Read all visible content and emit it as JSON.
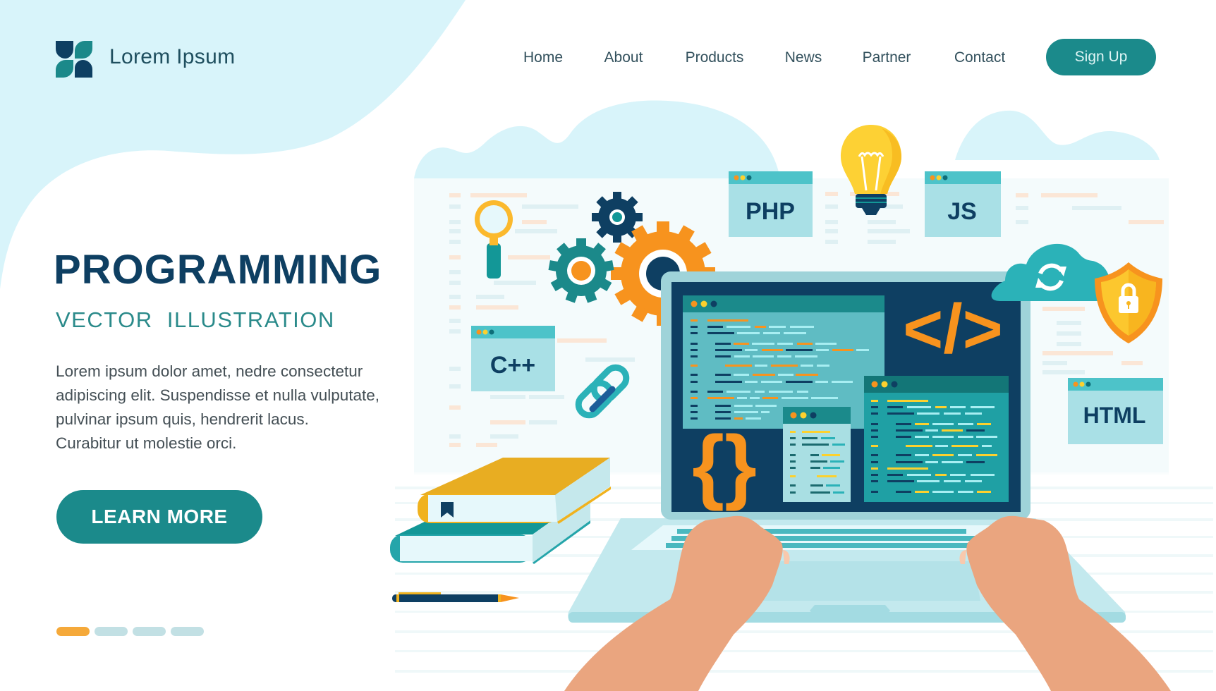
{
  "header": {
    "brand_name": "Lorem Ipsum",
    "logo_icon": "four-leaf-logo",
    "nav": [
      {
        "label": "Home"
      },
      {
        "label": "About"
      },
      {
        "label": "Products"
      },
      {
        "label": "News"
      },
      {
        "label": "Partner"
      },
      {
        "label": "Contact"
      }
    ],
    "signup_label": "Sign Up"
  },
  "hero": {
    "title": "PROGRAMMING",
    "subtitle": "VECTOR  ILLUSTRATION",
    "body_lines": [
      "Lorem ipsum dolor  amet, nedre consectetur",
      "adipiscing elit. Suspendisse et nulla vulputate,",
      "pulvinar ipsum quis, hendrerit lacus.",
      "Curabitur ut molestie orci."
    ],
    "cta_label": "LEARN MORE"
  },
  "pagination": {
    "count": 4,
    "active_index": 0
  },
  "illustration": {
    "code_tags": {
      "php": "PHP",
      "js": "JS",
      "cpp": "C++",
      "html": "HTML"
    },
    "code_symbol": "</>",
    "brace_symbol": "{}",
    "icons": [
      "magnifier-icon",
      "gear-icon",
      "lightbulb-icon",
      "cloud-sync-icon",
      "shield-lock-icon",
      "link-icon",
      "books-icon",
      "pencil-icon",
      "laptop-icon",
      "hands-icon"
    ]
  },
  "colors": {
    "primary": "#1b8a8b",
    "navy": "#0e3f62",
    "accent_orange": "#f7931e",
    "accent_yellow": "#fcc72e",
    "light_blue": "#d8f4fa",
    "skin": "#eaa57f"
  }
}
